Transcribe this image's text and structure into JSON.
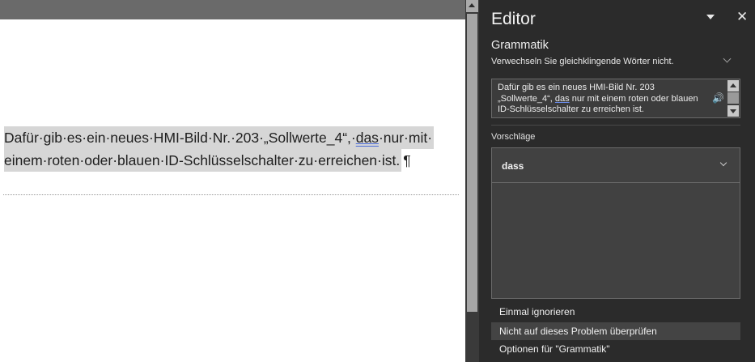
{
  "document": {
    "line1_before": "Dafür·gib·es·ein·neues·HMI-Bild·Nr.·203·„Sollwerte_4“,·",
    "line1_flagged": "das",
    "line1_after": "·nur·mit·",
    "line2": "einem·roten·oder·blauen·ID-Schlüsselschalter·zu·erreichen·ist.",
    "pilcrow": "¶"
  },
  "editor": {
    "title": "Editor",
    "close_glyph": "✕",
    "category": "Grammatik",
    "description": "Verwechseln Sie gleichklingende Wörter nicht.",
    "context_before": "Dafür gib es ein neues HMI-Bild Nr. 203 „Sollwerte_4“, ",
    "context_flagged": "das",
    "context_after": " nur mit einem roten oder blauen ID-Schlüsselschalter zu erreichen ist.",
    "speaker_glyph": "🔊",
    "suggestions_label": "Vorschläge",
    "suggestion": "dass",
    "actions": {
      "ignore": "Einmal ignorieren",
      "dont_check": "Nicht auf dieses Problem überprüfen",
      "options": "Optionen für \"Grammatik\""
    }
  },
  "icons": {
    "speaker": "speaker-icon",
    "close": "close-icon",
    "pane_menu": "chevron-down-icon"
  },
  "colors": {
    "pane_background": "#2b2b2b",
    "selection": "#d6d6d6",
    "flag_underline": "#4a6bd6"
  }
}
